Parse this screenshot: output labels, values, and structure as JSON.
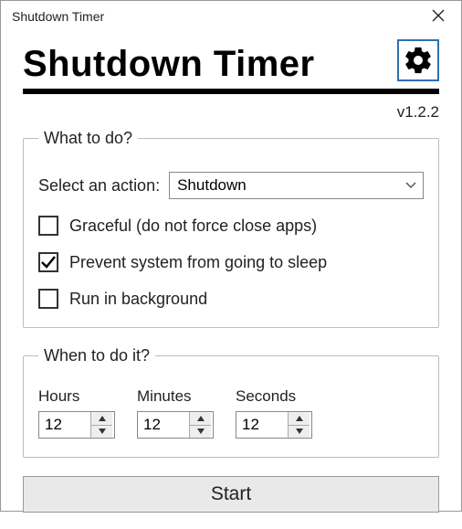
{
  "window": {
    "title": "Shutdown Timer"
  },
  "header": {
    "app_title": "Shutdown Timer",
    "version": "v1.2.2"
  },
  "what": {
    "legend": "What to do?",
    "select_label": "Select an action:",
    "selected_action": "Shutdown",
    "graceful": {
      "label": "Graceful (do not force close apps)",
      "checked": false
    },
    "prevent_sleep": {
      "label": "Prevent system from going to sleep",
      "checked": true
    },
    "background": {
      "label": "Run in background",
      "checked": false
    }
  },
  "when": {
    "legend": "When to do it?",
    "hours": {
      "label": "Hours",
      "value": "12"
    },
    "minutes": {
      "label": "Minutes",
      "value": "12"
    },
    "seconds": {
      "label": "Seconds",
      "value": "12"
    }
  },
  "start_label": "Start"
}
